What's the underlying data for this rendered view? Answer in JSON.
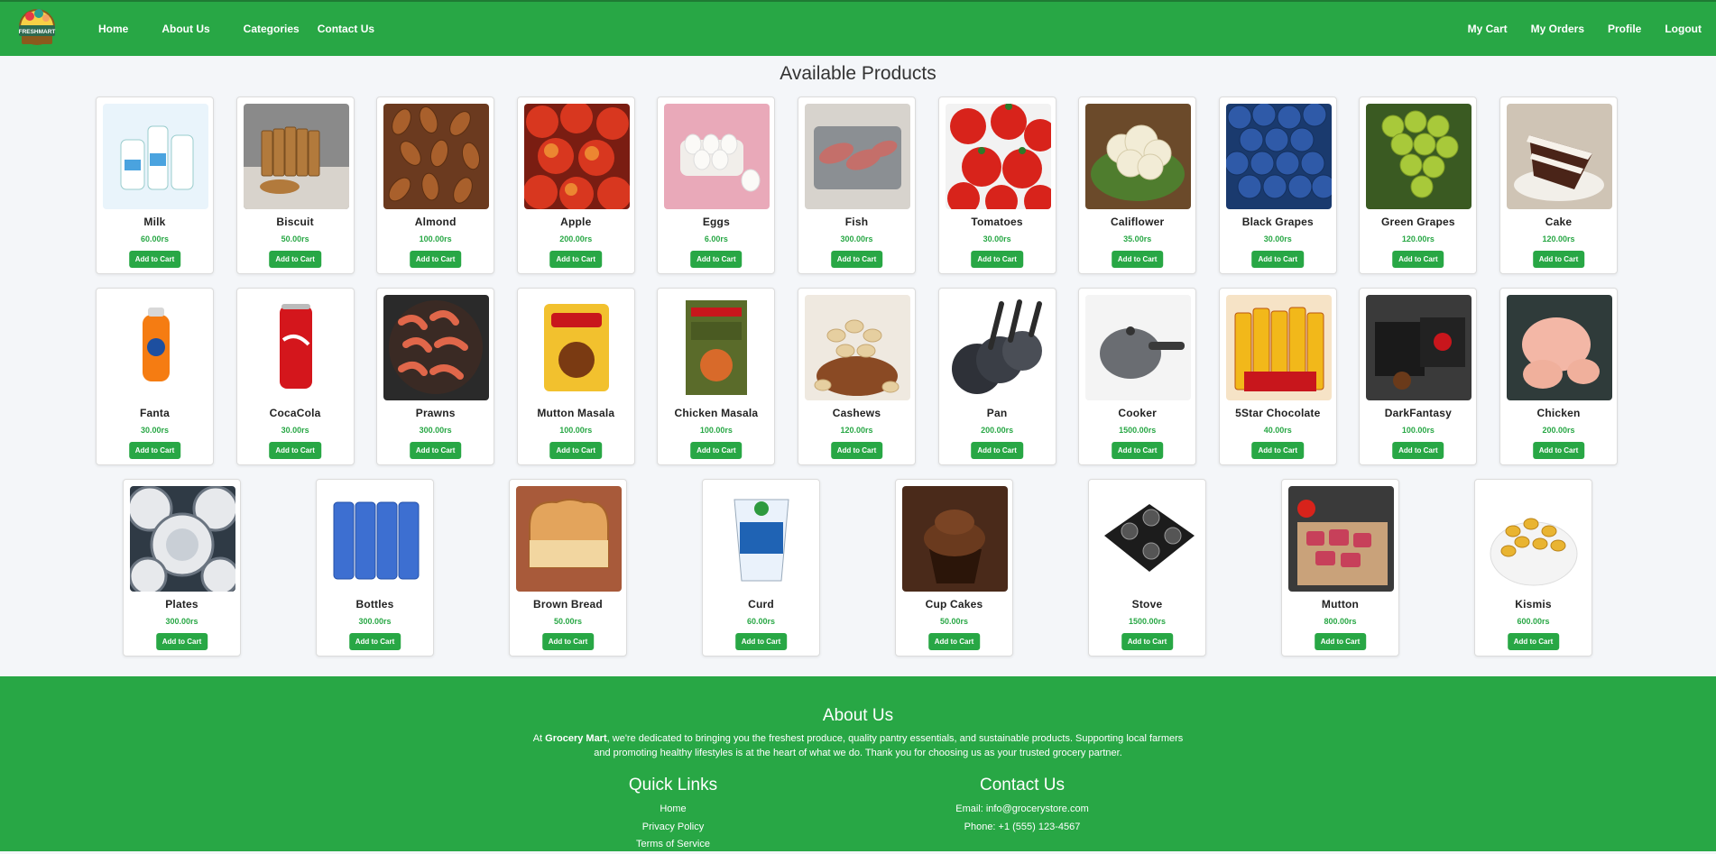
{
  "nav": {
    "logo_text": "FRESHMART",
    "left": [
      "Home",
      "About Us",
      "Categories",
      "Contact Us"
    ],
    "right": [
      "My Cart",
      "My Orders",
      "Profile",
      "Logout"
    ]
  },
  "page_title": "Available Products",
  "add_label": "Add to Cart",
  "products": [
    {
      "name": "Milk",
      "price": "60.00rs",
      "icon": "milk-icon"
    },
    {
      "name": "Biscuit",
      "price": "50.00rs",
      "icon": "biscuit-icon"
    },
    {
      "name": "Almond",
      "price": "100.00rs",
      "icon": "almond-icon"
    },
    {
      "name": "Apple",
      "price": "200.00rs",
      "icon": "apple-icon"
    },
    {
      "name": "Eggs",
      "price": "6.00rs",
      "icon": "eggs-icon"
    },
    {
      "name": "Fish",
      "price": "300.00rs",
      "icon": "fish-icon"
    },
    {
      "name": "Tomatoes",
      "price": "30.00rs",
      "icon": "tomatoes-icon"
    },
    {
      "name": "Califlower",
      "price": "35.00rs",
      "icon": "cauliflower-icon"
    },
    {
      "name": "Black Grapes",
      "price": "30.00rs",
      "icon": "black-grapes-icon"
    },
    {
      "name": "Green Grapes",
      "price": "120.00rs",
      "icon": "green-grapes-icon"
    },
    {
      "name": "Cake",
      "price": "120.00rs",
      "icon": "cake-icon"
    },
    {
      "name": "Fanta",
      "price": "30.00rs",
      "icon": "fanta-icon"
    },
    {
      "name": "CocaCola",
      "price": "30.00rs",
      "icon": "cocacola-icon"
    },
    {
      "name": "Prawns",
      "price": "300.00rs",
      "icon": "prawns-icon"
    },
    {
      "name": "Mutton Masala",
      "price": "100.00rs",
      "icon": "mutton-masala-icon"
    },
    {
      "name": "Chicken Masala",
      "price": "100.00rs",
      "icon": "chicken-masala-icon"
    },
    {
      "name": "Cashews",
      "price": "120.00rs",
      "icon": "cashews-icon"
    },
    {
      "name": "Pan",
      "price": "200.00rs",
      "icon": "pan-icon"
    },
    {
      "name": "Cooker",
      "price": "1500.00rs",
      "icon": "cooker-icon"
    },
    {
      "name": "5Star Chocolate",
      "price": "40.00rs",
      "icon": "chocolate-icon"
    },
    {
      "name": "DarkFantasy",
      "price": "100.00rs",
      "icon": "darkfantasy-icon"
    },
    {
      "name": "Chicken",
      "price": "200.00rs",
      "icon": "chicken-icon"
    },
    {
      "name": "Plates",
      "price": "300.00rs",
      "icon": "plates-icon"
    },
    {
      "name": "Bottles",
      "price": "300.00rs",
      "icon": "bottles-icon"
    },
    {
      "name": "Brown Bread",
      "price": "50.00rs",
      "icon": "bread-icon"
    },
    {
      "name": "Curd",
      "price": "60.00rs",
      "icon": "curd-icon"
    },
    {
      "name": "Cup Cakes",
      "price": "50.00rs",
      "icon": "cupcakes-icon"
    },
    {
      "name": "Stove",
      "price": "1500.00rs",
      "icon": "stove-icon"
    },
    {
      "name": "Mutton",
      "price": "800.00rs",
      "icon": "mutton-icon"
    },
    {
      "name": "Kismis",
      "price": "600.00rs",
      "icon": "kismis-icon"
    }
  ],
  "footer": {
    "about_title": "About Us",
    "about_prefix": "At ",
    "about_brand": "Grocery Mart",
    "about_text": ", we're dedicated to bringing you the freshest produce, quality pantry essentials, and sustainable products. Supporting local farmers and promoting healthy lifestyles is at the heart of what we do. Thank you for choosing us as your trusted grocery partner.",
    "links_title": "Quick Links",
    "links": [
      "Home",
      "Privacy Policy",
      "Terms of Service"
    ],
    "contact_title": "Contact Us",
    "email": "Email: info@grocerystore.com",
    "phone": "Phone: +1 (555) 123-4567"
  },
  "colors": {
    "brand_green": "#28a745",
    "background": "#f4f6f9"
  }
}
